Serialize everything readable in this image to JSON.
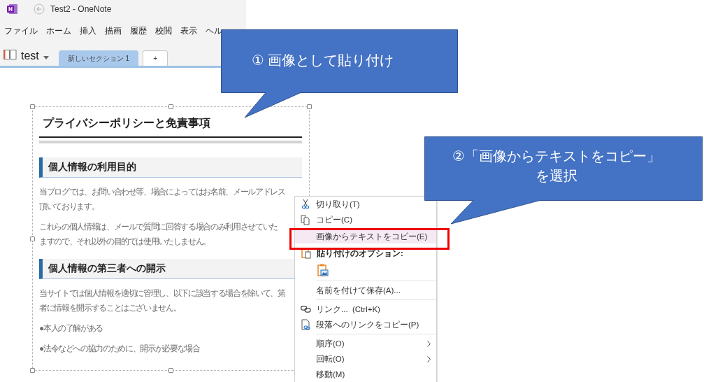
{
  "window": {
    "title": "Test2 - OneNote"
  },
  "menu_bar": [
    "ファイル",
    "ホーム",
    "挿入",
    "描画",
    "履歴",
    "校閲",
    "表示",
    "ヘル"
  ],
  "notebook": {
    "name": "test"
  },
  "section_tabs": [
    {
      "label": "新しいセクション 1",
      "selected": true
    },
    {
      "label": "+",
      "selected": false
    }
  ],
  "pasted_image": {
    "title": "プライバシーポリシーと免責事項",
    "blocks": [
      {
        "kind": "heading",
        "lines": [
          "個人情報の利用目的"
        ]
      },
      {
        "kind": "paragraph",
        "lines": [
          "当ブログでは、お問い合わせ等、場合によってはお名前、メールアドレス",
          "頂いております。"
        ]
      },
      {
        "kind": "paragraph",
        "lines": [
          "これらの個人情報は、メールで質問に回答する場合のみ利用させていた",
          "ますので、それ以外の目的では使用いたしません。"
        ]
      },
      {
        "kind": "heading",
        "lines": [
          "個人情報の第三者への開示"
        ]
      },
      {
        "kind": "paragraph",
        "lines": [
          "当サイトでは個人情報を適切に管理し、以下に該当する場合を除いて、第",
          "者に情報を開示することはございません。"
        ]
      },
      {
        "kind": "paragraph",
        "lines": [
          "●本人の了解がある"
        ]
      },
      {
        "kind": "paragraph",
        "lines": [
          "●法令などへの協力のために、開示が必要な場合"
        ]
      }
    ]
  },
  "context_menu": {
    "items": [
      {
        "kind": "cut",
        "label": "切り取り(T)",
        "selected": false
      },
      {
        "kind": "copy",
        "label": "コピー(C)",
        "selected": false
      },
      {
        "kind": "plain",
        "label": "画像からテキストをコピー(E)",
        "selected": true
      },
      {
        "kind": "heading",
        "label": "貼り付けのオプション:"
      },
      {
        "kind": "paste"
      },
      {
        "kind": "separator"
      },
      {
        "kind": "plain",
        "label": "名前を付けて保存(A)...",
        "selected": false
      },
      {
        "kind": "separator"
      },
      {
        "kind": "link",
        "label": "リンク...  (Ctrl+K)",
        "selected": false
      },
      {
        "kind": "paragraph",
        "label": "段落へのリンクをコピー(P)",
        "selected": false
      },
      {
        "kind": "separator"
      },
      {
        "kind": "submenu",
        "label": "順序(O)",
        "selected": false
      },
      {
        "kind": "submenu",
        "label": "回転(O)",
        "selected": false
      },
      {
        "kind": "plain",
        "label": "移動(M)",
        "selected": false
      }
    ]
  },
  "callouts": [
    {
      "lines": [
        "① 画像として貼り付け"
      ]
    },
    {
      "lines": [
        "②「画像からテキストをコピー」",
        "を選択"
      ]
    }
  ]
}
